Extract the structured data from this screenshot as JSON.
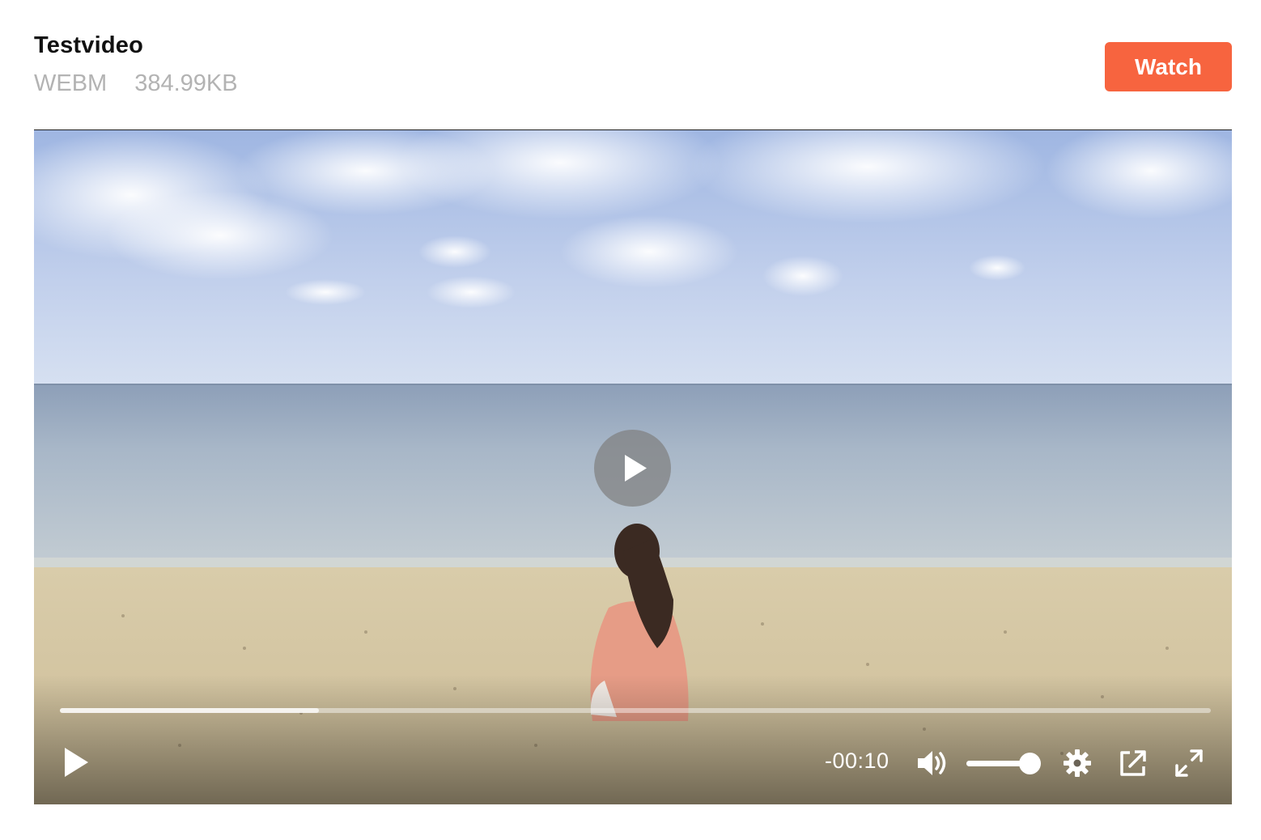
{
  "file": {
    "title": "Testvideo",
    "format": "WEBM",
    "size": "384.99KB"
  },
  "actions": {
    "watch_label": "Watch"
  },
  "player": {
    "time_remaining": "-00:10",
    "progress_buffered": 0.225,
    "volume_level": 1.0,
    "controls": {
      "play_icon": "play-icon",
      "big_play_icon": "play-icon",
      "volume_icon": "volume-icon",
      "settings_icon": "gear-icon",
      "popout_icon": "external-link-icon",
      "fullscreen_icon": "fullscreen-icon"
    }
  },
  "colors": {
    "accent": "#f7643f",
    "meta_text": "#b3b3b3",
    "title_text": "#111111"
  }
}
